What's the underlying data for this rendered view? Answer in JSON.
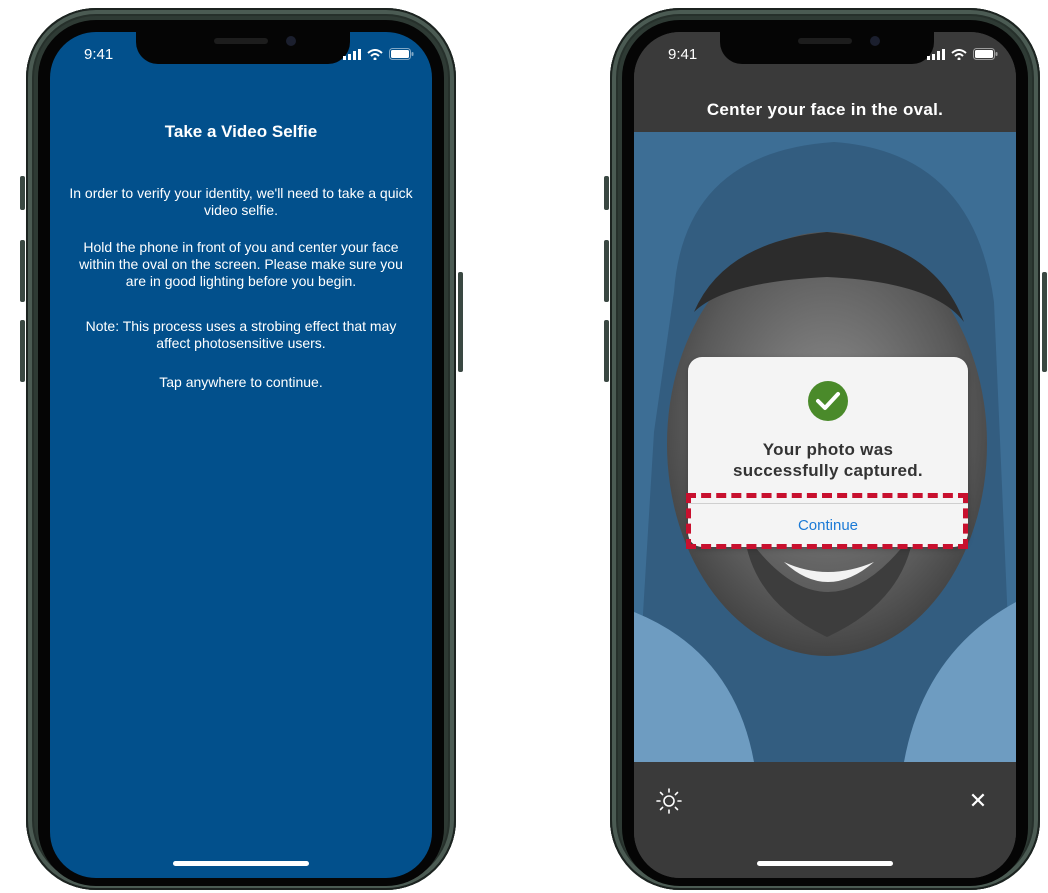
{
  "left_phone": {
    "status_time": "9:41",
    "title": "Take a Video Selfie",
    "paragraphs": {
      "p1": "In order to verify your identity, we'll need to take a quick video selfie.",
      "p2": "Hold the phone in front of you and center your face within the oval on the screen.  Please make sure you are in good lighting before you begin.",
      "p3": "Note: This process uses a strobing effect that may affect photosensitive users.",
      "p4": "Tap anywhere to continue."
    },
    "background_color": "#02508c"
  },
  "right_phone": {
    "status_time": "9:41",
    "header_title": "Center your face in the oval.",
    "modal": {
      "message_line1": "Your photo was",
      "message_line2": "successfully captured.",
      "continue_label": "Continue",
      "check_color": "#4a8a2a"
    },
    "footer": {
      "left_icon": "brightness-icon",
      "right_icon": "close-icon",
      "close_glyph": "✕"
    },
    "highlight_color": "#c8102e"
  }
}
